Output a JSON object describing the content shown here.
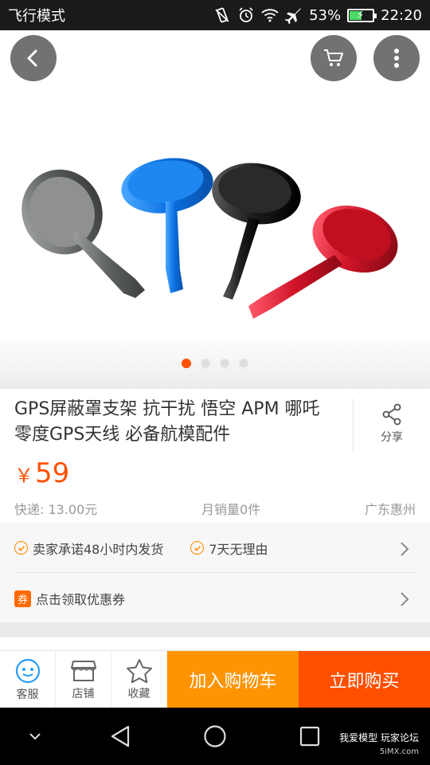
{
  "status_bar": {
    "mode_label": "飞行模式",
    "battery_percent": "53%",
    "battery_level": 0.53,
    "time": "22:20"
  },
  "hero": {
    "image_icon": "product-photo",
    "pager_total": 4,
    "pager_active": 1
  },
  "product": {
    "title": "GPS屏蔽罩支架 抗干扰 悟空 APM 哪吒 零度GPS天线 必备航模配件",
    "share_label": "分享",
    "currency": "￥",
    "price": "59",
    "shipping": "快递: 13.00元",
    "monthly_sales": "月销量0件",
    "location": "广东惠州"
  },
  "services": {
    "promise1": "卖家承诺48小时内发货",
    "promise2": "7天无理由",
    "coupon_icon_text": "券",
    "coupon_label": "点击领取优惠券"
  },
  "action_bar": {
    "service_label": "客服",
    "shop_label": "店铺",
    "favorite_label": "收藏",
    "add_cart_label": "加入购物车",
    "buy_label": "立即购买"
  },
  "watermark": {
    "line1": "我爱模型 玩家论坛",
    "line2": "5iMX.com"
  },
  "colors": {
    "accent": "#ff5000",
    "cart_button": "#ff9402"
  }
}
